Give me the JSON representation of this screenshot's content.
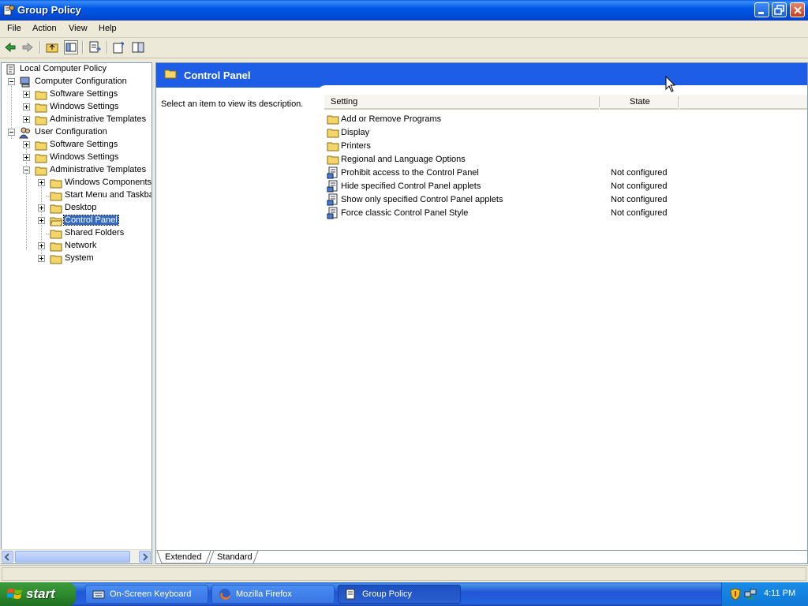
{
  "window": {
    "title": "Group Policy"
  },
  "menu": [
    "File",
    "Action",
    "View",
    "Help"
  ],
  "toolbar": {
    "icons": [
      "back-arrow-icon",
      "forward-arrow-icon",
      "up-folder-icon",
      "show-hide-tree-icon",
      "export-list-icon",
      "properties-help-icon",
      "console-icon"
    ]
  },
  "tree": {
    "root": "Local Computer Policy",
    "computer_config": "Computer Configuration",
    "cc_software": "Software Settings",
    "cc_windows": "Windows Settings",
    "cc_admin": "Administrative Templates",
    "user_config": "User Configuration",
    "uc_software": "Software Settings",
    "uc_windows": "Windows Settings",
    "uc_admin": "Administrative Templates",
    "windows_components": "Windows Components",
    "start_menu": "Start Menu and Taskba",
    "desktop": "Desktop",
    "control_panel": "Control Panel",
    "shared_folders": "Shared Folders",
    "network": "Network",
    "system": "System"
  },
  "details": {
    "header_title": "Control Panel",
    "description": "Select an item to view its description.",
    "col_setting": "Setting",
    "col_state": "State",
    "rows": [
      {
        "name": "Add or Remove Programs",
        "state": "",
        "icon": "folder-icon"
      },
      {
        "name": "Display",
        "state": "",
        "icon": "folder-icon"
      },
      {
        "name": "Printers",
        "state": "",
        "icon": "folder-icon"
      },
      {
        "name": "Regional and Language Options",
        "state": "",
        "icon": "folder-icon"
      },
      {
        "name": "Prohibit access to the Control Panel",
        "state": "Not configured",
        "icon": "policy-setting-icon"
      },
      {
        "name": "Hide specified Control Panel applets",
        "state": "Not configured",
        "icon": "policy-setting-icon"
      },
      {
        "name": "Show only specified Control Panel applets",
        "state": "Not configured",
        "icon": "policy-setting-icon"
      },
      {
        "name": "Force classic Control Panel Style",
        "state": "Not configured",
        "icon": "policy-setting-icon"
      }
    ]
  },
  "tabs": [
    "Extended",
    "Standard"
  ],
  "taskbar": {
    "start": "start",
    "tasks": [
      "On-Screen Keyboard",
      "Mozilla Firefox",
      "Group Policy"
    ],
    "clock": "4:11 PM"
  },
  "colors": {
    "accent": "#1e5ee6",
    "selection": "#316ac5"
  }
}
